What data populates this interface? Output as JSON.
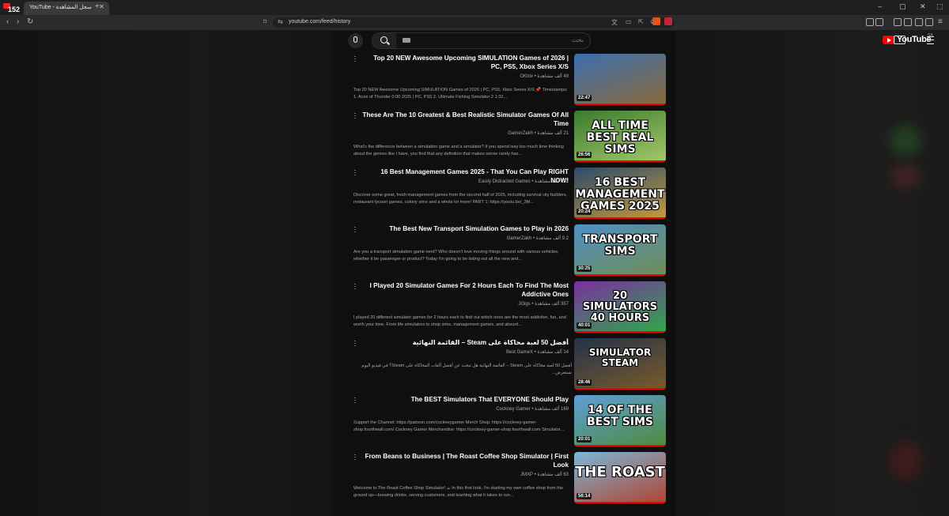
{
  "browser": {
    "tab_title": "YouTube - سجل المشاهدة",
    "notification_count": "152",
    "url": "youtube.com/feed/history"
  },
  "masthead": {
    "search_placeholder": "بحث",
    "logo_text": "YouTube",
    "region": "SA"
  },
  "videos": [
    {
      "title": "Top 20 NEW Awesome Upcoming SIMULATION Games of 2026 | PC, PS5, Xbox Series X/S",
      "meta": "49 ألف مشاهدة • OKtrix",
      "description": "Top 20 NEW Awesome Upcoming SIMULATION Games of 2026 | PC, PS5, Xbox Series X/S 📌 Timestamps: 1. Aces of Thunder 0:00 2025 | PC, PS5 2. Ultimate Fishing Simulator 2 1:32...",
      "duration": "22:47",
      "thumb_text": "",
      "colors": [
        "#3b6fb0",
        "#8a6a3a"
      ]
    },
    {
      "title": "These Are The 10 Greatest & Best Realistic Simulator Games Of All Time",
      "meta": "21 ألف مشاهدة • GamerZakh",
      "description": "What's the difference between a simulation game and a simulator? If you spend way too much time thinking about the genres like I have, you find that any definition that makes sense rarely has...",
      "duration": "26:56",
      "thumb_text": "ALL TIME BEST REAL SIMS",
      "colors": [
        "#3a7b2e",
        "#a4c86a"
      ]
    },
    {
      "title": "16 Best Management Games 2025 - That You Can Play RIGHT NOW!",
      "meta": "122 ألف مشاهدة • Easily Distracted Games",
      "description": "Discover some great, fresh management games from the second half of 2025, including survival city builders, restaurant tycoon games, colony sims and a whole lot more! PART 1: https://youtu.be/_3M...",
      "duration": "20:24",
      "thumb_text": "16 BEST MANAGEMENT GAMES 2025",
      "colors": [
        "#2c4a6a",
        "#c49b3b"
      ]
    },
    {
      "title": "The Best New Transport Simulation Games to Play in 2026",
      "meta": "9.2 ألف مشاهدة • GamerZakh",
      "description": "Are you a transport simulation game nerd? Who doesn't love moving things around with various vehicles, whether it be passenger or product? Today I'm going to be listing out all the new and...",
      "duration": "30:25",
      "thumb_text": "TRANSPORT SIMS",
      "colors": [
        "#4f8fc4",
        "#6f8d55"
      ]
    },
    {
      "title": "I Played 20 Simulator Games For 2 Hours Each To Find The Most Addictive Ones",
      "meta": "357 ألف مشاهدة • JGigs",
      "description": "I played 20 different simulator games for 2 hours each to find out which ones are the most addictive, fun, and worth your time. From life simulators to shop sims, management games, and absurd...",
      "duration": "40:01",
      "thumb_text": "20 SIMULATORS 40 HOURS",
      "colors": [
        "#7a2ea0",
        "#2fa94a"
      ]
    },
    {
      "title": "أفضل 50 لعبة محاكاة على Steam – القائمة النهائية",
      "meta": "14 ألف مشاهدة • Best GameX",
      "description": "أفضل 50 لعبة محاكاة على Steam – القائمة النهائية هل تبحث عن أفضل ألعاب المحاكاة على Steam؟ في فيديو اليوم نستعرض...",
      "duration": "28:46",
      "thumb_text": "SIMULATOR STEAM",
      "colors": [
        "#23324a",
        "#7a5b2a"
      ]
    },
    {
      "title": "The BEST Simulators That EVERYONE Should Play",
      "meta": "169 ألف مشاهدة • Cockney Gamer",
      "description": "Support the Channel: https://patreon.com/cockneygamer Merch Shop: https://cockney-gamer-shop.fourthwall.com/ Cockney Gamer Merchandise: https://cockney-gamer-shop.fourthwall.com Simulator...",
      "duration": "20:01",
      "thumb_text": "14 OF THE BEST SIMS",
      "colors": [
        "#5d9fd8",
        "#4e8a3c"
      ]
    },
    {
      "title": "From Beans to Business | The Roast Coffee Shop Simulator | First Look",
      "meta": "63 ألف مشاهدة • JMXP",
      "description": "Welcome to The Roast Coffee Shop Simulator! ☕ In this first look, I'm starting my own coffee shop from the ground up—brewing drinks, serving customers, and learning what it takes to run...",
      "duration": "56:14",
      "thumb_text": "THE ROAST",
      "colors": [
        "#7bb6d8",
        "#b0442f"
      ]
    }
  ]
}
